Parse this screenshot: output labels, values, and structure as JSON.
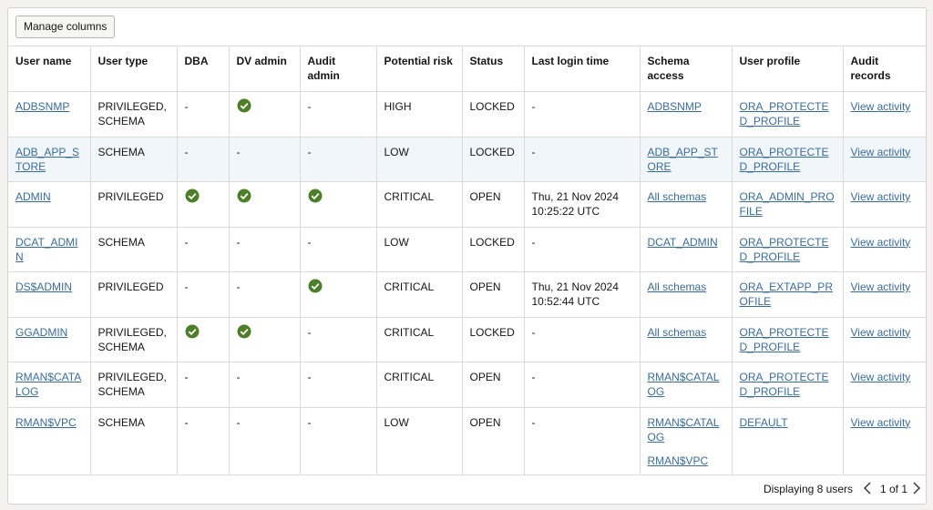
{
  "toolbar": {
    "manage_columns_label": "Manage columns"
  },
  "columns": [
    "User name",
    "User type",
    "DBA",
    "DV admin",
    "Audit admin",
    "Potential risk",
    "Status",
    "Last login time",
    "Schema access",
    "User profile",
    "Audit records"
  ],
  "rows": [
    {
      "user_name": "ADBSNMP",
      "user_type": "PRIVILEGED, SCHEMA",
      "dba": "-",
      "dv_admin": "check",
      "audit_admin": "-",
      "risk": "HIGH",
      "status": "LOCKED",
      "last_login": "-",
      "schema_access": [
        "ADBSNMP"
      ],
      "profile": "ORA_PROTECTED_PROFILE",
      "audit": "View activity"
    },
    {
      "user_name": "ADB_APP_STORE",
      "user_type": "SCHEMA",
      "dba": "-",
      "dv_admin": "-",
      "audit_admin": "-",
      "risk": "LOW",
      "status": "LOCKED",
      "last_login": "-",
      "schema_access": [
        "ADB_APP_STORE"
      ],
      "profile": "ORA_PROTECTED_PROFILE",
      "audit": "View activity"
    },
    {
      "user_name": "ADMIN",
      "user_type": "PRIVILEGED",
      "dba": "check",
      "dv_admin": "check",
      "audit_admin": "check",
      "risk": "CRITICAL",
      "status": "OPEN",
      "last_login": "Thu, 21 Nov 2024 10:25:22 UTC",
      "schema_access": [
        "All schemas"
      ],
      "profile": "ORA_ADMIN_PROFILE",
      "audit": "View activity"
    },
    {
      "user_name": "DCAT_ADMIN",
      "user_type": "SCHEMA",
      "dba": "-",
      "dv_admin": "-",
      "audit_admin": "-",
      "risk": "LOW",
      "status": "LOCKED",
      "last_login": "-",
      "schema_access": [
        "DCAT_ADMIN"
      ],
      "profile": "ORA_PROTECTED_PROFILE",
      "audit": "View activity"
    },
    {
      "user_name": "DS$ADMIN",
      "user_type": "PRIVILEGED",
      "dba": "-",
      "dv_admin": "-",
      "audit_admin": "check",
      "risk": "CRITICAL",
      "status": "OPEN",
      "last_login": "Thu, 21 Nov 2024 10:52:44 UTC",
      "schema_access": [
        "All schemas"
      ],
      "profile": "ORA_EXTAPP_PROFILE",
      "audit": "View activity"
    },
    {
      "user_name": "GGADMIN",
      "user_type": "PRIVILEGED, SCHEMA",
      "dba": "check",
      "dv_admin": "check",
      "audit_admin": "-",
      "risk": "CRITICAL",
      "status": "LOCKED",
      "last_login": "-",
      "schema_access": [
        "All schemas"
      ],
      "profile": "ORA_PROTECTED_PROFILE",
      "audit": "View activity"
    },
    {
      "user_name": "RMAN$CATALOG",
      "user_type": "PRIVILEGED, SCHEMA",
      "dba": "-",
      "dv_admin": "-",
      "audit_admin": "-",
      "risk": "CRITICAL",
      "status": "OPEN",
      "last_login": "-",
      "schema_access": [
        "RMAN$CATALOG"
      ],
      "profile": "ORA_PROTECTED_PROFILE",
      "audit": "View activity"
    },
    {
      "user_name": "RMAN$VPC",
      "user_type": "SCHEMA",
      "dba": "-",
      "dv_admin": "-",
      "audit_admin": "-",
      "risk": "LOW",
      "status": "OPEN",
      "last_login": "-",
      "schema_access": [
        "RMAN$CATALOG",
        "RMAN$VPC"
      ],
      "profile": "DEFAULT",
      "audit": "View activity"
    }
  ],
  "footer": {
    "count_text": "Displaying 8 users",
    "page_text": "1 of 1"
  },
  "colors": {
    "check_green": "#4d7e2a",
    "link": "#3a6c9a",
    "highlight_row": "#f1f6fa"
  },
  "icons": {
    "check": "check-circle-icon",
    "prev": "chevron-left-icon",
    "next": "chevron-right-icon"
  }
}
